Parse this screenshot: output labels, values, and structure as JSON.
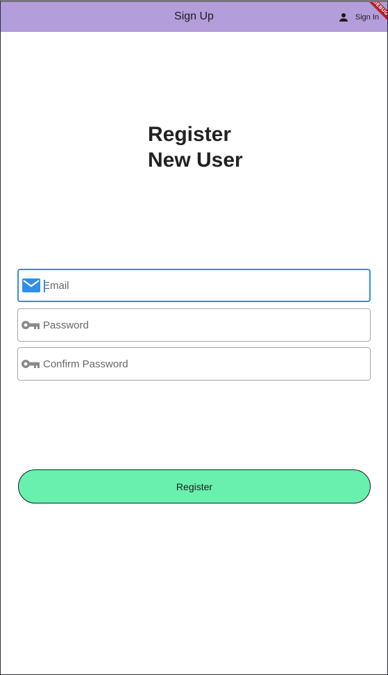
{
  "appbar": {
    "title": "Sign Up",
    "signin_label": "Sign In",
    "signin_icon": "person-icon",
    "background": "#b39ddb"
  },
  "debug_banner": "DEBUG",
  "heading": {
    "line1": "Register",
    "line2": "New User"
  },
  "form": {
    "email": {
      "placeholder": "Email",
      "value": "",
      "icon": "mail-icon",
      "icon_color": "#2f8ee8",
      "focused": true
    },
    "password": {
      "placeholder": "Password",
      "value": "",
      "icon": "key-icon",
      "icon_color": "#8a8a8a"
    },
    "confirm_password": {
      "placeholder": "Confirm Password",
      "value": "",
      "icon": "key-icon",
      "icon_color": "#8a8a8a"
    }
  },
  "register_button": {
    "label": "Register",
    "background": "#69f0ae"
  }
}
